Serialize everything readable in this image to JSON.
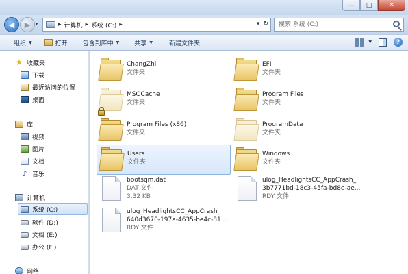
{
  "window": {
    "min": "—",
    "max": "□",
    "close": "✕"
  },
  "address": {
    "back": "◀",
    "forward": "▶",
    "crumbs": [
      "计算机",
      "系统 (C:)"
    ],
    "sep": "▸",
    "dropdown": "▾",
    "refresh": "↻"
  },
  "search": {
    "placeholder": "搜索 系统 (C:)"
  },
  "toolbar": {
    "organize": "组织",
    "open": "打开",
    "include_library": "包含到库中",
    "share": "共享",
    "new_folder": "新建文件夹",
    "help": "?"
  },
  "navpane": {
    "favorites": "收藏夹",
    "downloads": "下载",
    "recent": "最近访问的位置",
    "desktop": "桌面",
    "libraries": "库",
    "videos": "视频",
    "pictures": "图片",
    "documents": "文档",
    "music": "音乐",
    "computer": "计算机",
    "drive_c": "系统 (C:)",
    "drive_d": "软件 (D:)",
    "drive_e": "文档 (E:)",
    "drive_f": "办公 (F:)",
    "network": "网络"
  },
  "files": [
    {
      "name": "ChangZhi",
      "type": "文件夹"
    },
    {
      "name": "EFI",
      "type": "文件夹"
    },
    {
      "name": "MSOCache",
      "type": "文件夹"
    },
    {
      "name": "Program Files",
      "type": "文件夹"
    },
    {
      "name": "Program Files (x86)",
      "type": "文件夹"
    },
    {
      "name": "ProgramData",
      "type": "文件夹"
    },
    {
      "name": "Users",
      "type": "文件夹"
    },
    {
      "name": "Windows",
      "type": "文件夹"
    },
    {
      "name": "bootsqm.dat",
      "type": "DAT 文件",
      "size": "3.32 KB"
    },
    {
      "name": "ulog_HeadlightsCC_AppCrash_",
      "name2": "3b7771bd-18c3-45fa-bd8e-ae...",
      "type": "RDY 文件"
    },
    {
      "name": "ulog_HeadlightsCC_AppCrash_",
      "name2": "640d3670-197a-4635-be4c-81...",
      "type": "RDY 文件"
    }
  ],
  "colors": {
    "selection": "#d6e7fb",
    "folder": "#e8c465",
    "accent": "#2e6fc2"
  }
}
